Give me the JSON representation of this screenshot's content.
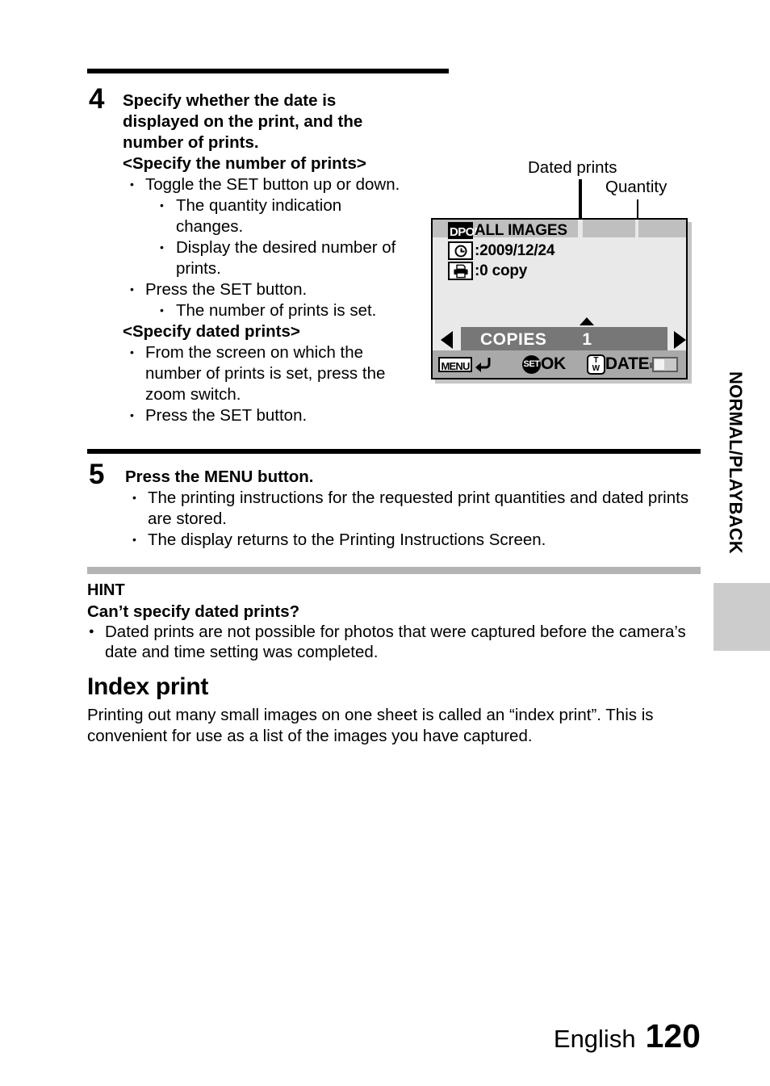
{
  "page": {
    "footer_language": "English",
    "footer_page_number": "120",
    "side_tab_label": "NORMAL/PLAYBACK"
  },
  "steps": [
    {
      "number": "4",
      "title": "Specify whether the date is displayed on the print, and the number of prints.",
      "sub_head_1": "<Specify the number of prints>",
      "bullets_1": [
        {
          "text": "Toggle the SET button up or down.",
          "sub": [
            "The quantity indication changes.",
            "Display the desired number of prints."
          ]
        },
        {
          "text": "Press the SET button.",
          "sub": [
            "The number of prints is set."
          ]
        }
      ],
      "sub_head_2": "<Specify dated prints>",
      "bullets_2": [
        {
          "text": "From the screen on which the number of prints is set, press the zoom switch.",
          "sub": []
        },
        {
          "text": "Press the SET button.",
          "sub": []
        }
      ]
    },
    {
      "number": "5",
      "title": "Press the MENU button.",
      "bullets_1": [
        {
          "text": "The printing instructions for the requested print quantities and dated prints are stored.",
          "sub": []
        },
        {
          "text": "The display returns to the Printing Instructions Screen.",
          "sub": []
        }
      ]
    }
  ],
  "callouts": {
    "dated_prints": "Dated prints",
    "quantity": "Quantity"
  },
  "lcd_screen": {
    "dpof_badge": "DPOF",
    "title": "ALL IMAGES",
    "date_value": ":2009/12/24",
    "copies_value_info": ":0 copy",
    "copies_label": "COPIES",
    "copies_quantity": "1",
    "menu_badge": "MENU",
    "set_badge": "SET",
    "set_action": "OK",
    "zoom_badge_top": "T",
    "zoom_badge_bottom": "W",
    "zoom_action": "DATE",
    "colors": {
      "screen_background": "#e9e9e9",
      "header_band": "#bfbfbf",
      "selection_bar": "#777777",
      "bottom_bar": "#a9a9a9",
      "border": "#000000"
    }
  },
  "hint": {
    "label": "HINT",
    "question": "Can’t specify dated prints?",
    "bullets": [
      "Dated prints are not possible for photos that were captured before the camera’s date and time setting was completed."
    ]
  },
  "section": {
    "title": "Index print",
    "body": "Printing out many small images on one sheet is called an “index print”. This is convenient for use as a list of the images you have captured."
  }
}
